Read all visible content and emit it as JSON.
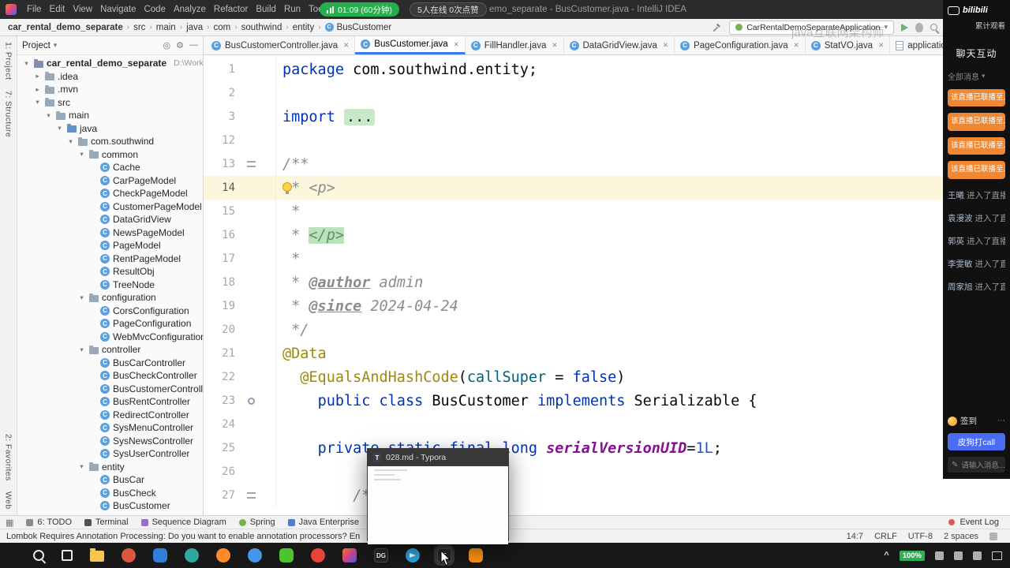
{
  "menubar": {
    "menus": [
      "File",
      "Edit",
      "View",
      "Navigate",
      "Code",
      "Analyze",
      "Refactor",
      "Build",
      "Run",
      "Tools"
    ],
    "stream_timer": "01:09 (60分钟)",
    "stream_stats": "5人在线 0次点赞",
    "window_title": "emo_separate - BusCustomer.java - IntelliJ IDEA"
  },
  "toolbar": {
    "breadcrumbs": [
      "car_rental_demo_separate",
      "src",
      "main",
      "java",
      "com",
      "southwind",
      "entity",
      "BusCustomer"
    ],
    "run_config": "CarRentalDemoSeparateApplication",
    "watermark": "java互联网架构师"
  },
  "tool_strips": {
    "left_top": [
      "1: Project",
      "7: Structure"
    ],
    "left_bottom": [
      "2: Favorites",
      "Web"
    ]
  },
  "project": {
    "header": "Project",
    "tree": [
      {
        "indent": 0,
        "arrow": "v",
        "icon": "project",
        "label": "car_rental_demo_separate",
        "extra": "D:\\WorkSpace\\Id",
        "bold": true
      },
      {
        "indent": 1,
        "arrow": ">",
        "icon": "folder",
        "label": ".idea"
      },
      {
        "indent": 1,
        "arrow": ">",
        "icon": "folder",
        "label": ".mvn"
      },
      {
        "indent": 1,
        "arrow": "v",
        "icon": "folder",
        "label": "src"
      },
      {
        "indent": 2,
        "arrow": "v",
        "icon": "folder",
        "label": "main"
      },
      {
        "indent": 3,
        "arrow": "v",
        "icon": "source",
        "label": "java"
      },
      {
        "indent": 4,
        "arrow": "v",
        "icon": "package",
        "label": "com.southwind"
      },
      {
        "indent": 5,
        "arrow": "v",
        "icon": "package",
        "label": "common"
      },
      {
        "indent": 6,
        "icon": "class",
        "label": "Cache"
      },
      {
        "indent": 6,
        "icon": "class",
        "label": "CarPageModel"
      },
      {
        "indent": 6,
        "icon": "class",
        "label": "CheckPageModel"
      },
      {
        "indent": 6,
        "icon": "class",
        "label": "CustomerPageModel"
      },
      {
        "indent": 6,
        "icon": "class",
        "label": "DataGridView"
      },
      {
        "indent": 6,
        "icon": "class",
        "label": "NewsPageModel"
      },
      {
        "indent": 6,
        "icon": "class",
        "label": "PageModel"
      },
      {
        "indent": 6,
        "icon": "class",
        "label": "RentPageModel"
      },
      {
        "indent": 6,
        "icon": "class",
        "label": "ResultObj"
      },
      {
        "indent": 6,
        "icon": "class",
        "label": "TreeNode"
      },
      {
        "indent": 5,
        "arrow": "v",
        "icon": "package",
        "label": "configuration"
      },
      {
        "indent": 6,
        "icon": "class",
        "label": "CorsConfiguration"
      },
      {
        "indent": 6,
        "icon": "class",
        "label": "PageConfiguration"
      },
      {
        "indent": 6,
        "icon": "class",
        "label": "WebMvcConfiguration"
      },
      {
        "indent": 5,
        "arrow": "v",
        "icon": "package",
        "label": "controller"
      },
      {
        "indent": 6,
        "icon": "class",
        "label": "BusCarController"
      },
      {
        "indent": 6,
        "icon": "class",
        "label": "BusCheckController"
      },
      {
        "indent": 6,
        "icon": "class",
        "label": "BusCustomerController"
      },
      {
        "indent": 6,
        "icon": "class",
        "label": "BusRentController"
      },
      {
        "indent": 6,
        "icon": "class",
        "label": "RedirectController"
      },
      {
        "indent": 6,
        "icon": "class",
        "label": "SysMenuController"
      },
      {
        "indent": 6,
        "icon": "class",
        "label": "SysNewsController"
      },
      {
        "indent": 6,
        "icon": "class",
        "label": "SysUserController"
      },
      {
        "indent": 5,
        "arrow": "v",
        "icon": "package",
        "label": "entity"
      },
      {
        "indent": 6,
        "icon": "class",
        "label": "BusCar"
      },
      {
        "indent": 6,
        "icon": "class",
        "label": "BusCheck"
      },
      {
        "indent": 6,
        "icon": "class",
        "label": "BusCustomer"
      }
    ]
  },
  "editor": {
    "tabs": [
      {
        "label": "BusCustomerController.java",
        "icon": "class",
        "close": true
      },
      {
        "label": "BusCustomer.java",
        "icon": "class",
        "close": true,
        "active": true
      },
      {
        "label": "FillHandler.java",
        "icon": "class",
        "close": true
      },
      {
        "label": "DataGridView.java",
        "icon": "class",
        "close": true
      },
      {
        "label": "PageConfiguration.java",
        "icon": "class",
        "close": true
      },
      {
        "label": "StatVO.java",
        "icon": "class",
        "close": true
      },
      {
        "label": "application.yml",
        "icon": "yml",
        "close": true
      }
    ],
    "code": [
      {
        "n": "1",
        "seg": [
          [
            "package ",
            "kw"
          ],
          [
            "com.southwind.entity;",
            "p"
          ]
        ]
      },
      {
        "n": "2",
        "seg": []
      },
      {
        "n": "3",
        "seg": [
          [
            "import ",
            "kw"
          ],
          [
            "...",
            "fold"
          ]
        ]
      },
      {
        "n": "12",
        "seg": []
      },
      {
        "n": "13",
        "gutter": "doc",
        "seg": [
          [
            "/**",
            "c"
          ]
        ]
      },
      {
        "n": "14",
        "hl": true,
        "bulb": true,
        "seg": [
          [
            " * ",
            "c"
          ],
          [
            "<p>",
            "c"
          ]
        ]
      },
      {
        "n": "15",
        "seg": [
          [
            " *",
            "c"
          ]
        ]
      },
      {
        "n": "16",
        "seg": [
          [
            " * ",
            "c"
          ],
          [
            "</p>",
            "chl"
          ]
        ]
      },
      {
        "n": "17",
        "seg": [
          [
            " *",
            "c"
          ]
        ]
      },
      {
        "n": "18",
        "seg": [
          [
            " * ",
            "c"
          ],
          [
            "@author",
            "tag"
          ],
          [
            " admin",
            "c"
          ]
        ]
      },
      {
        "n": "19",
        "seg": [
          [
            " * ",
            "c"
          ],
          [
            "@since",
            "tag"
          ],
          [
            " 2024-04-24",
            "c"
          ]
        ]
      },
      {
        "n": "20",
        "seg": [
          [
            " */",
            "c"
          ]
        ]
      },
      {
        "n": "21",
        "seg": [
          [
            "@Data",
            "an"
          ]
        ]
      },
      {
        "n": "22",
        "seg": [
          [
            "  ",
            "p"
          ],
          [
            "@EqualsAndHashCode",
            "an"
          ],
          [
            "(",
            "p"
          ],
          [
            "callSuper",
            "at"
          ],
          [
            " = ",
            "p"
          ],
          [
            "false",
            "kw"
          ],
          [
            ")",
            "p"
          ]
        ]
      },
      {
        "n": "23",
        "gutter": "ov",
        "seg": [
          [
            "    ",
            "p"
          ],
          [
            "public class ",
            "kw"
          ],
          [
            "BusCustomer ",
            "p"
          ],
          [
            "implements ",
            "kw"
          ],
          [
            "Serializable {",
            "p"
          ]
        ]
      },
      {
        "n": "24",
        "seg": []
      },
      {
        "n": "25",
        "seg": [
          [
            "    ",
            "p"
          ],
          [
            "private static final long ",
            "kw"
          ],
          [
            "serialVersionUID",
            "sf"
          ],
          [
            "=",
            "p"
          ],
          [
            "1L",
            "num"
          ],
          [
            ";",
            "p"
          ]
        ]
      },
      {
        "n": "26",
        "seg": []
      },
      {
        "n": "27",
        "gutter": "doc",
        "seg": [
          [
            "        ",
            "p"
          ],
          [
            "/**",
            "c"
          ]
        ]
      }
    ]
  },
  "status": {
    "tools": [
      {
        "label": "6: TODO",
        "icon": "todo"
      },
      {
        "label": "Terminal",
        "icon": "terminal"
      },
      {
        "label": "Sequence Diagram",
        "icon": "seq"
      },
      {
        "label": "Spring",
        "icon": "spring"
      },
      {
        "label": "Java Enterprise",
        "icon": "jee"
      }
    ],
    "event_log": "Event Log",
    "message": "Lombok Requires Annotation Processing: Do you want to enable annotation processors? En",
    "caret": "14:7",
    "line_ending": "CRLF",
    "encoding": "UTF-8",
    "indent": "2 spaces"
  },
  "bili": {
    "logo_text": "bilibili",
    "views_label": "累计观看",
    "chat_title": "聊天互动",
    "filter_label": "全部消息",
    "banners": [
      "该直播已联播至..",
      "该直播已联播至..",
      "该直播已联播至..",
      "该直播已联播至.."
    ],
    "messages": [
      [
        "王曦",
        "进入了直播"
      ],
      [
        "袁漫波",
        "进入了直播"
      ],
      [
        "郭英",
        "进入了直播"
      ],
      [
        "李雯敏",
        "进入了直播"
      ],
      [
        "周家旭",
        "进入了直播"
      ]
    ],
    "signin_label": "签到",
    "call_button": "皮狗打call",
    "input_placeholder": "请输入消息..."
  },
  "typora": {
    "title": "028.md - Typora"
  },
  "taskbar": {
    "battery": "100%",
    "apps": [
      {
        "name": "search-icon",
        "type": "magnifier"
      },
      {
        "name": "task-view-icon",
        "type": "taskview"
      },
      {
        "name": "file-explorer-icon",
        "type": "folder"
      },
      {
        "name": "app-icon-1",
        "type": "circle",
        "color": "#d8593f"
      },
      {
        "name": "app-icon-2",
        "type": "square",
        "color": "#2f7ed8"
      },
      {
        "name": "app-icon-3",
        "type": "circle",
        "color": "#2fa8a0"
      },
      {
        "name": "firefox-icon",
        "type": "circle",
        "color": "#ff8a2b"
      },
      {
        "name": "app-icon-4",
        "type": "circle",
        "color": "#4596e6"
      },
      {
        "name": "wechat-icon",
        "type": "square",
        "color": "#49c52f"
      },
      {
        "name": "app-icon-5",
        "type": "circle",
        "color": "#e8443a"
      },
      {
        "name": "intellij-idea-icon",
        "type": "gradient"
      },
      {
        "name": "datagrip-icon",
        "type": "dark",
        "label": "DG"
      },
      {
        "name": "telegram-icon",
        "type": "plane",
        "color": "#2ea6dd"
      },
      {
        "name": "typora-icon",
        "type": "dark",
        "label": "T",
        "active": true
      },
      {
        "name": "screenshot-tool-icon",
        "type": "square",
        "color": "#ff9518"
      }
    ]
  }
}
